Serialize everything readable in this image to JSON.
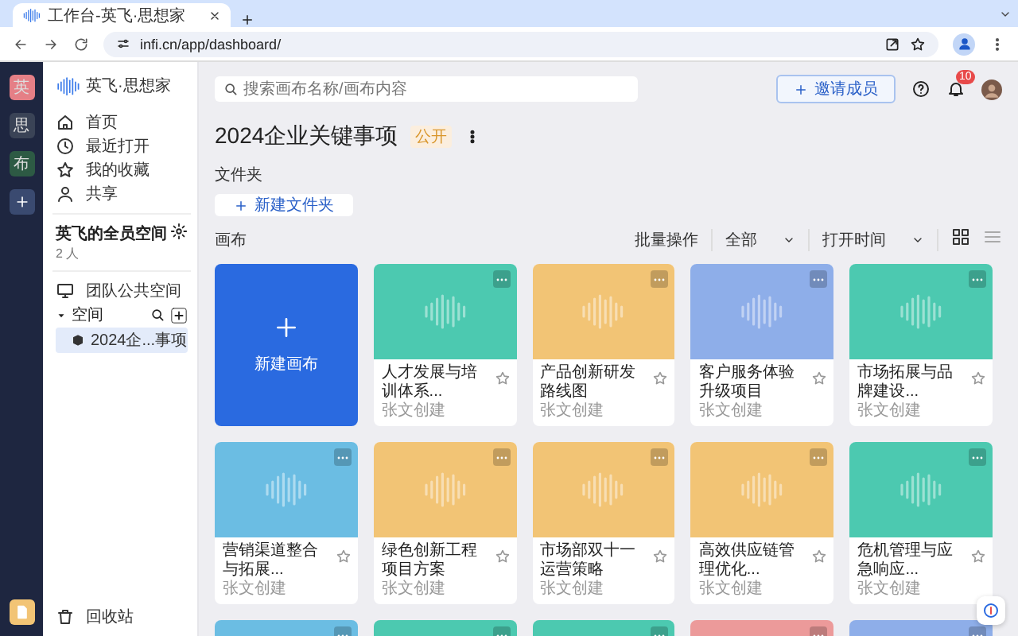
{
  "browser": {
    "tab_title": "工作台-英飞·思想家",
    "url": "infi.cn/app/dashboard/"
  },
  "rail": {
    "items": [
      {
        "label": "英",
        "color": "#e57f86"
      },
      {
        "label": "思",
        "color": "#3a4356"
      },
      {
        "label": "布",
        "color": "#2d5a44"
      }
    ]
  },
  "sidebar": {
    "logo_text": "英飞·思想家",
    "nav": [
      {
        "label": "首页",
        "kind": "home"
      },
      {
        "label": "最近打开",
        "kind": "recent"
      },
      {
        "label": "我的收藏",
        "kind": "favorites"
      },
      {
        "label": "共享",
        "kind": "shared"
      }
    ],
    "space": {
      "name": "英飞的全员空间",
      "members": "2 人"
    },
    "team_space": "团队公共空间",
    "section": {
      "label": "空间",
      "expanded": true
    },
    "tree": [
      {
        "label": "2024企...事项",
        "selected": true
      }
    ],
    "trash": "回收站"
  },
  "header": {
    "search_placeholder": "搜索画布名称/画布内容",
    "invite_label": "邀请成员",
    "notification_count": "10"
  },
  "board": {
    "title": "2024企业关键事项",
    "visibility": "公开",
    "folders_label": "文件夹",
    "new_folder_label": "新建文件夹",
    "canvases_label": "画布",
    "batch_label": "批量操作",
    "filter": "全部",
    "sort": "打开时间",
    "view_options": [
      {
        "kind": "grid",
        "selected": true
      },
      {
        "kind": "list",
        "selected": false
      }
    ],
    "new_canvas_label": "新建画布",
    "cards": [
      {
        "title": "人才发展与培训体系...",
        "creator": "张文创建",
        "color": "#4cc9b0"
      },
      {
        "title": "产品创新研发路线图",
        "creator": "张文创建",
        "color": "#f2c475"
      },
      {
        "title": "客户服务体验升级项目",
        "creator": "张文创建",
        "color": "#8eaee9"
      },
      {
        "title": "市场拓展与品牌建设...",
        "creator": "张文创建",
        "color": "#4cc9b0"
      },
      {
        "title": "营销渠道整合与拓展...",
        "creator": "张文创建",
        "color": "#6bbde3"
      },
      {
        "title": "绿色创新工程项目方案",
        "creator": "张文创建",
        "color": "#f2c475"
      },
      {
        "title": "市场部双十一运营策略",
        "creator": "张文创建",
        "color": "#f2c475"
      },
      {
        "title": "高效供应链管理优化...",
        "creator": "张文创建",
        "color": "#f2c475"
      },
      {
        "title": "危机管理与应急响应...",
        "creator": "张文创建",
        "color": "#4cc9b0"
      },
      {
        "color": "#6bbde3"
      },
      {
        "color": "#4cc9b0"
      },
      {
        "color": "#4cc9b0"
      },
      {
        "color": "#ec9a9a"
      },
      {
        "color": "#8eaee9"
      }
    ]
  }
}
